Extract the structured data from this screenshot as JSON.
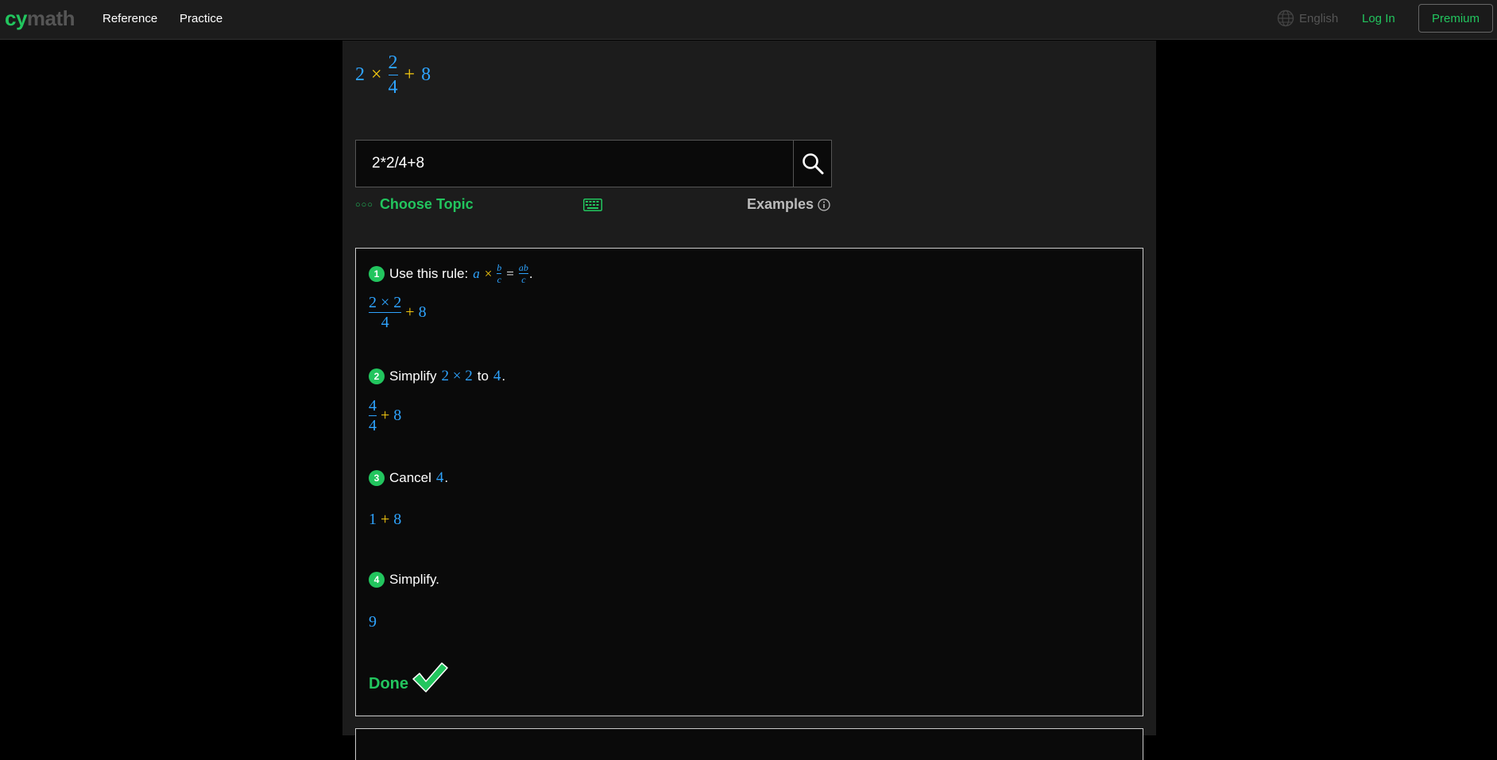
{
  "nav": {
    "logo_cy": "cy",
    "logo_math": "math",
    "reference": "Reference",
    "practice": "Practice",
    "language": "English",
    "login": "Log In",
    "premium": "Premium"
  },
  "preview": {
    "a": "2",
    "times": "×",
    "num": "2",
    "den": "4",
    "plus": "+",
    "b": "8"
  },
  "search": {
    "value": "2*2/4+8"
  },
  "controls": {
    "dots": "○○○",
    "choose_topic": "Choose Topic",
    "examples": "Examples"
  },
  "steps": {
    "s1": {
      "num": "1",
      "text": "Use this rule:",
      "rule_a": "a",
      "rule_times": "×",
      "rule_b": "b",
      "rule_c": "c",
      "rule_eq": "=",
      "rule_ab": "ab",
      "rule_c2": "c",
      "period": ".",
      "res_num": "2 × 2",
      "res_den": "4",
      "res_plus": "+",
      "res_b": "8"
    },
    "s2": {
      "num": "2",
      "text": "Simplify",
      "expr": "2 × 2",
      "to": "to",
      "val": "4",
      "period": ".",
      "res_num": "4",
      "res_den": "4",
      "res_plus": "+",
      "res_b": "8"
    },
    "s3": {
      "num": "3",
      "text": "Cancel",
      "val": "4",
      "period": ".",
      "res_a": "1",
      "res_plus": "+",
      "res_b": "8"
    },
    "s4": {
      "num": "4",
      "text": "Simplify.",
      "res": "9"
    },
    "done": "Done"
  },
  "colors": {
    "accent_green": "#22c55e",
    "math_blue": "#2ea4ff",
    "math_yellow": "#f5c90f"
  }
}
